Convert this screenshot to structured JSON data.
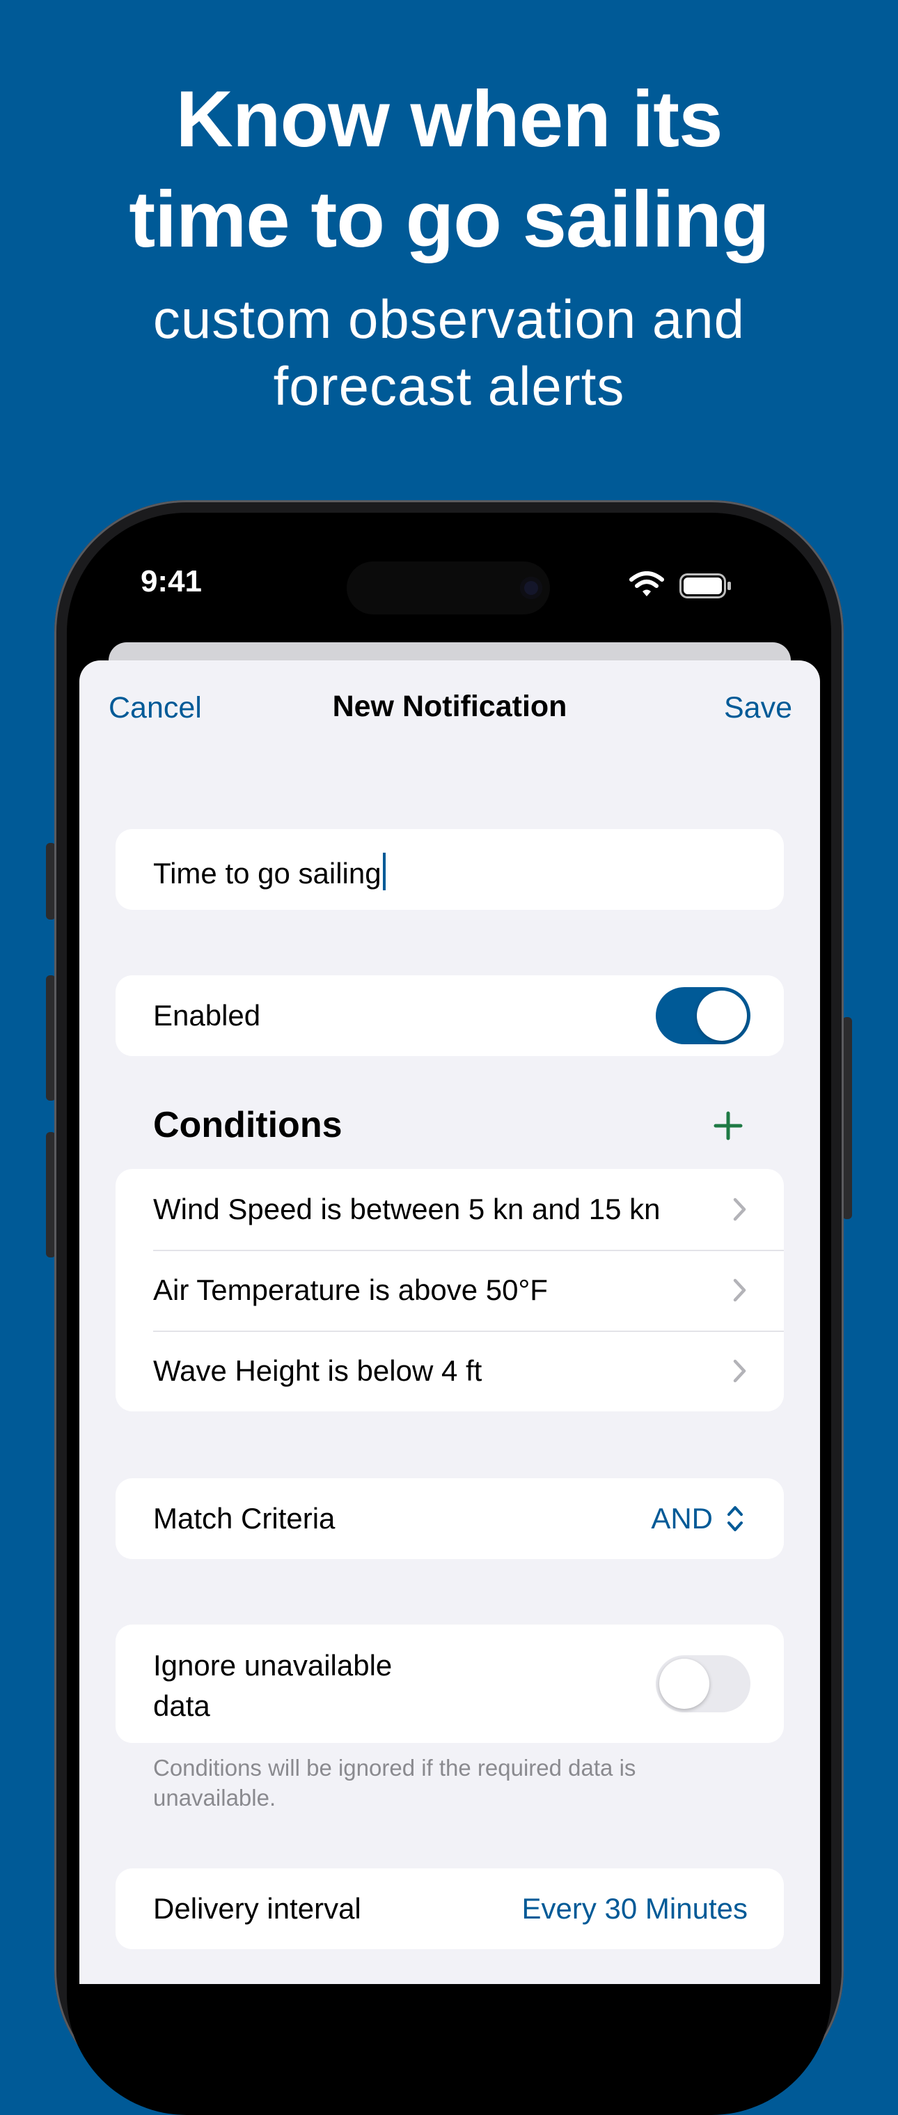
{
  "headline": {
    "line1": "Know when its",
    "line2": "time to go sailing"
  },
  "subhead": {
    "line1": "custom observation and",
    "line2": "forecast alerts"
  },
  "status_bar": {
    "time": "9:41"
  },
  "nav": {
    "cancel": "Cancel",
    "title": "New Notification",
    "save": "Save"
  },
  "name_field": {
    "value": "Time to go sailing"
  },
  "enabled": {
    "label": "Enabled",
    "on": true
  },
  "conditions": {
    "title": "Conditions",
    "items": [
      "Wind Speed is between 5 kn and 15 kn",
      "Air Temperature is above 50°F",
      "Wave Height is below 4 ft"
    ]
  },
  "match_criteria": {
    "label": "Match Criteria",
    "value": "AND"
  },
  "ignore_unavailable": {
    "label_line1": "Ignore unavailable",
    "label_line2": "data",
    "on": false,
    "footnote_line1": "Conditions will be ignored if the required data is",
    "footnote_line2": "unavailable."
  },
  "delivery": {
    "label": "Delivery interval",
    "value": "Every 30 Minutes"
  },
  "colors": {
    "background": "#005A97",
    "accent": "#005A97",
    "add": "#1F7A45",
    "sheet": "#F2F2F7"
  }
}
